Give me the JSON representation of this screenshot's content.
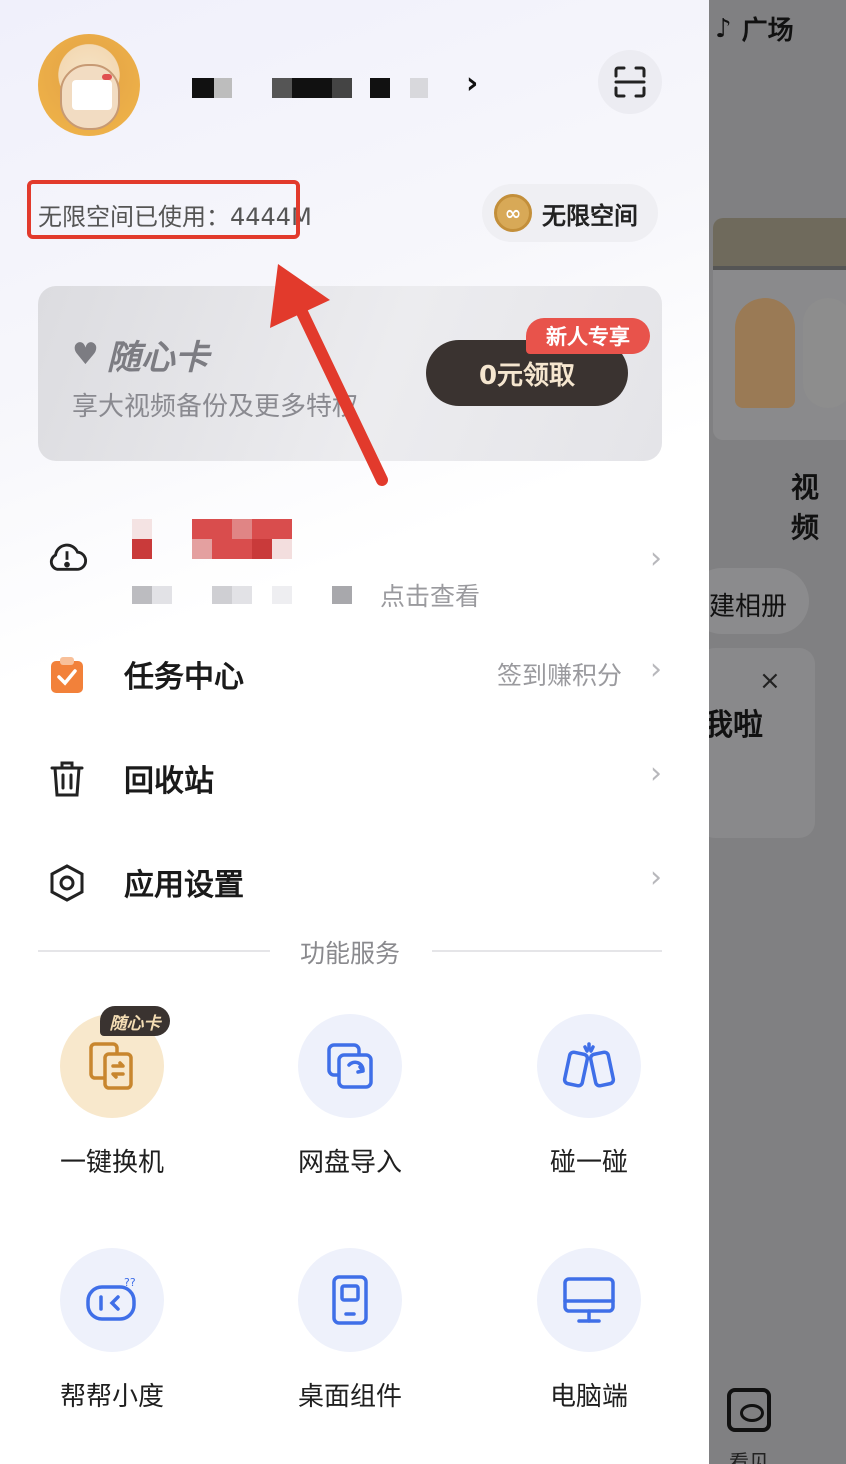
{
  "background_app": {
    "top_label": "广场",
    "video_label": "视频",
    "pill_label": "建相册",
    "close_glyph": "×",
    "card_text": "我啦",
    "bottom_label": "看见"
  },
  "header": {
    "chevron": "›"
  },
  "storage": {
    "usage_text": "无限空间已使用：4444M",
    "pill_label": "无限空间"
  },
  "promo_card": {
    "title": "随心卡",
    "subtitle": "享大视频备份及更多特权",
    "cta": "0元领取",
    "badge": "新人专享"
  },
  "menu": {
    "notice_link": "点击查看",
    "task_center": {
      "label": "任务中心",
      "hint": "签到赚积分"
    },
    "recycle_bin": {
      "label": "回收站"
    },
    "app_settings": {
      "label": "应用设置"
    }
  },
  "services": {
    "section_title": "功能服务",
    "items": [
      {
        "label": "一键换机",
        "icon": "phone-transfer-icon",
        "badge": "随心卡"
      },
      {
        "label": "网盘导入",
        "icon": "import-icon"
      },
      {
        "label": "碰一碰",
        "icon": "phones-tap-icon"
      },
      {
        "label": "帮帮小度",
        "icon": "assistant-icon"
      },
      {
        "label": "桌面组件",
        "icon": "widget-icon"
      },
      {
        "label": "电脑端",
        "icon": "monitor-icon"
      }
    ]
  },
  "colors": {
    "accent_red": "#e23a2c",
    "icon_blue": "#3f6fe8",
    "cta_dark": "#3a3330",
    "badge_red": "#e8534b"
  }
}
